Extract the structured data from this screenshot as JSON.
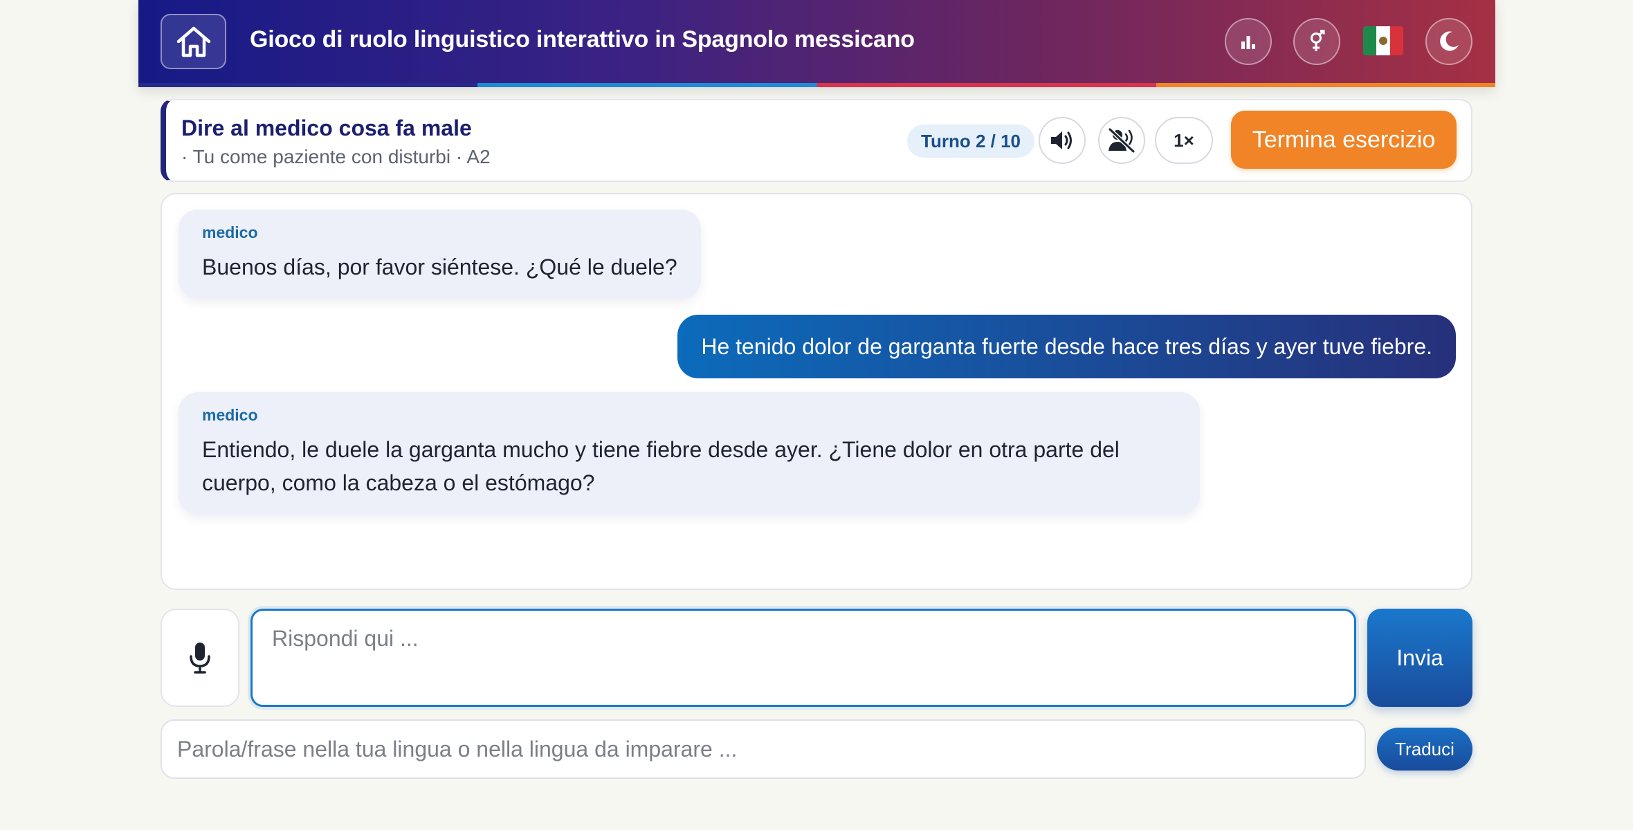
{
  "header": {
    "title": "Gioco di ruolo linguistico interattivo in Spagnolo messicano",
    "home_icon": "home-icon",
    "stats_icon": "bar-chart-icon",
    "gender_icon": "gender-icon",
    "flag_icon": "mexico-flag-icon",
    "theme_icon": "moon-icon",
    "strip_colors": [
      "#262a8a",
      "#1f8ad6",
      "#d8344e",
      "#f08426"
    ]
  },
  "exercise": {
    "title": "Dire al medico cosa fa male",
    "subtitle": "· Tu come paziente con disturbi · A2",
    "turn_label": "Turno 2 / 10",
    "speaker_icon": "volume-icon",
    "mute_icon": "voice-off-icon",
    "speed_label": "1×",
    "end_label": "Termina esercizio"
  },
  "chat": {
    "messages": [
      {
        "role": "incoming",
        "speaker": "medico",
        "text": "Buenos días, por favor siéntese. ¿Qué le duele?"
      },
      {
        "role": "outgoing",
        "text": "He tenido dolor de garganta fuerte desde hace tres días y ayer tuve fiebre."
      },
      {
        "role": "incoming",
        "speaker": "medico",
        "text": "Entiendo, le duele la garganta mucho y tiene fiebre desde ayer. ¿Tiene dolor en otra parte del cuerpo, como la cabeza o el estómago?"
      }
    ]
  },
  "input": {
    "mic_icon": "microphone-icon",
    "answer_placeholder": "Rispondi qui ...",
    "answer_value": "",
    "send_label": "Invia",
    "translate_placeholder": "Parola/frase nella tua lingua o nella lingua da imparare ...",
    "translate_value": "",
    "translate_label": "Traduci"
  },
  "colors": {
    "accent_orange": "#f08426",
    "accent_blue": "#1b78c8",
    "bubble_in": "#edf0f8",
    "header_start": "#161a86",
    "header_end": "#a53044"
  }
}
